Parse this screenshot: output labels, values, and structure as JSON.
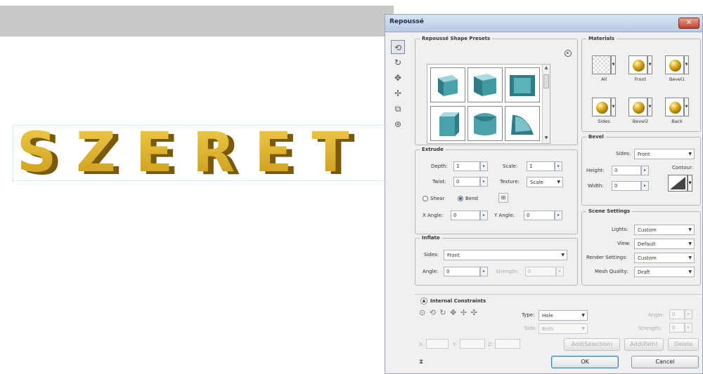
{
  "canvas": {
    "text": "SZERET"
  },
  "dialog": {
    "title": "Repoussé",
    "close_glyph": "✕",
    "presets": {
      "legend": "Repoussé Shape Presets",
      "options_glyph": "▸"
    },
    "materials": {
      "legend": "Materials",
      "items": [
        {
          "label": "All"
        },
        {
          "label": "Front"
        },
        {
          "label": "Bevel1"
        },
        {
          "label": "Sides"
        },
        {
          "label": "Bevel2"
        },
        {
          "label": "Back"
        }
      ]
    },
    "extrude": {
      "legend": "Extrude",
      "depth_label": "Depth:",
      "depth_value": "1",
      "scale_label": "Scale:",
      "scale_value": "1",
      "twist_label": "Twist:",
      "twist_value": "0",
      "texture_label": "Texture:",
      "texture_value": "Scale",
      "shear_label": "Shear",
      "bend_label": "Bend",
      "xangle_label": "X Angle:",
      "xangle_value": "0",
      "yangle_label": "Y Angle:",
      "yangle_value": "0"
    },
    "bevel": {
      "legend": "Bevel",
      "sides_label": "Sides:",
      "sides_value": "Front",
      "height_label": "Height:",
      "height_value": "0",
      "width_label": "Width:",
      "width_value": "0",
      "contour_label": "Contour:"
    },
    "inflate": {
      "legend": "Inflate",
      "sides_label": "Sides:",
      "sides_value": "Front",
      "angle_label": "Angle:",
      "angle_value": "0",
      "strength_label": "Strength:",
      "strength_value": "0"
    },
    "scene": {
      "legend": "Scene Settings",
      "lights_label": "Lights:",
      "lights_value": "Custom",
      "view_label": "View:",
      "view_value": "Default",
      "render_label": "Render Settings:",
      "render_value": "Custom",
      "mesh_label": "Mesh Quality:",
      "mesh_value": "Draft"
    },
    "constraints": {
      "legend": "Internal Constraints",
      "type_label": "Type:",
      "type_value": "Hole",
      "side_label": "Side:",
      "side_value": "Both",
      "angle_label": "Angle:",
      "angle_value": "0",
      "strength_label": "Strength:",
      "strength_value": "0",
      "x_label": "X:",
      "y_label": "Y:",
      "z_label": "Z:"
    },
    "buttons": {
      "add_selection": "Add(Selection)",
      "add_path": "Add(Path)",
      "delete": "Delete",
      "ok": "OK",
      "cancel": "Cancel"
    }
  }
}
